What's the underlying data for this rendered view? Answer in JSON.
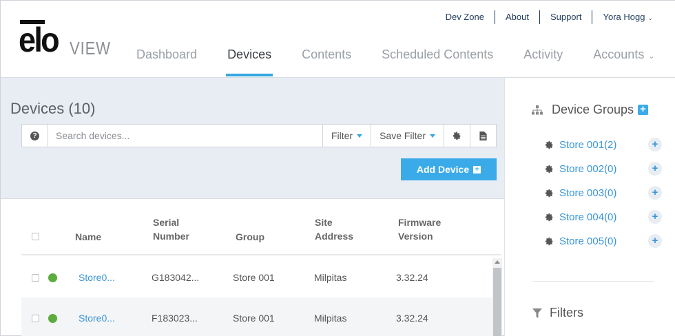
{
  "logo": {
    "brand": "elo",
    "product": "VIEW"
  },
  "top_links": [
    {
      "label": "Dev Zone"
    },
    {
      "label": "About"
    },
    {
      "label": "Support"
    },
    {
      "label": "Yora Hogg"
    }
  ],
  "nav": {
    "tabs": [
      {
        "label": "Dashboard"
      },
      {
        "label": "Devices"
      },
      {
        "label": "Contents"
      },
      {
        "label": "Scheduled Contents"
      },
      {
        "label": "Activity"
      },
      {
        "label": "Accounts"
      }
    ],
    "active_tab": "Devices"
  },
  "devices": {
    "title": "Devices (10)",
    "search_placeholder": "Search devices...",
    "search_value": "",
    "filter_label": "Filter",
    "save_filter_label": "Save Filter",
    "add_device_label": "Add Device"
  },
  "table": {
    "columns": {
      "name": "Name",
      "serial_line1": "Serial",
      "serial_line2": "Number",
      "group": "Group",
      "site_line1": "Site",
      "site_line2": "Address",
      "firmware_line1": "Firmware",
      "firmware_line2": "Version"
    },
    "rows": [
      {
        "name": "Store0...",
        "serial": "G183042...",
        "group": "Store 001",
        "site": "Milpitas",
        "firmware": "3.32.24",
        "status": "online"
      },
      {
        "name": "Store0...",
        "serial": "F183023...",
        "group": "Store 001",
        "site": "Milpitas",
        "firmware": "3.32.24",
        "status": "online"
      }
    ]
  },
  "device_groups": {
    "title": "Device Groups",
    "items": [
      {
        "label": "Store 001(2)"
      },
      {
        "label": "Store 002(0)"
      },
      {
        "label": "Store 003(0)"
      },
      {
        "label": "Store 004(0)"
      },
      {
        "label": "Store 005(0)"
      }
    ]
  },
  "filters": {
    "title": "Filters"
  },
  "colors": {
    "accent": "#35a8e0",
    "button": "#3aabe8",
    "link": "#3a95d8",
    "online": "#5cac3e",
    "panel_bg": "#e8edf3"
  },
  "icons": {
    "help": "question-circle-icon",
    "settings": "gear-icon",
    "export": "document-icon",
    "groups": "hierarchy-icon",
    "filters": "funnel-icon"
  }
}
